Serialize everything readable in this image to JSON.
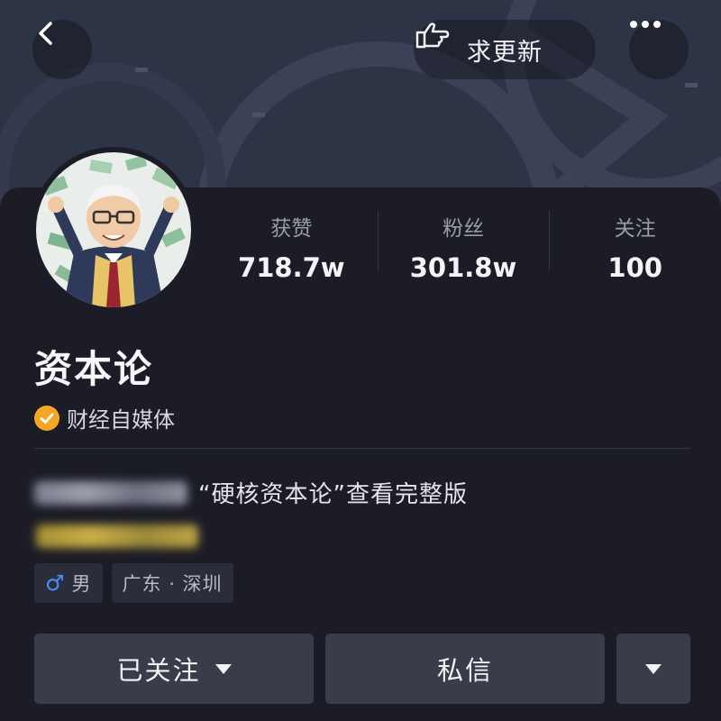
{
  "header": {
    "back_icon": "chevron-left-icon",
    "request_update_label": "求更新",
    "request_update_icon": "pointing-hand-icon",
    "more_icon": "more-dots-icon"
  },
  "profile": {
    "name": "资本论",
    "verification": {
      "icon": "check-badge-icon",
      "label": "财经自媒体",
      "color": "#f5a623"
    },
    "stats": [
      {
        "label": "获赞",
        "value": "718.7w"
      },
      {
        "label": "粉丝",
        "value": "301.8w"
      },
      {
        "label": "关注",
        "value": "100"
      }
    ],
    "bio": {
      "line1_visible": "“硬核资本论”查看完整版"
    },
    "tags": [
      {
        "icon": "male-icon",
        "label": "男"
      },
      {
        "label": "广东 · 深圳"
      }
    ]
  },
  "actions": {
    "follow_label": "已关注",
    "message_label": "私信"
  },
  "colors": {
    "background": "#1b1c26",
    "banner": "#2d3446",
    "button": "#3a3c49",
    "tag": "#2b2d3a",
    "male_icon": "#4c8bf5"
  }
}
